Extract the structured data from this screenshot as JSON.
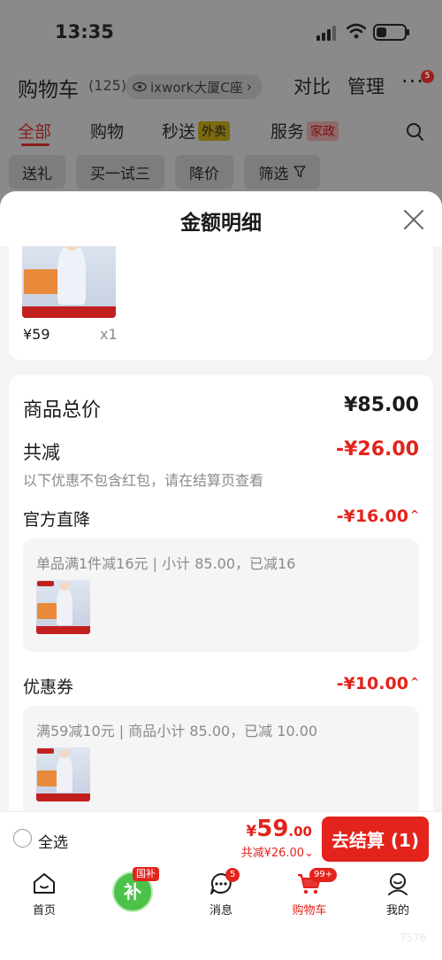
{
  "status_bar": {
    "time": "13:35"
  },
  "cart_header": {
    "title": "购物车",
    "count": "(125)",
    "location": "ixwork大厦C座",
    "compare": "对比",
    "manage": "管理",
    "more_badge": "5"
  },
  "tabs": [
    {
      "label": "全部",
      "active": true
    },
    {
      "label": "购物"
    },
    {
      "label": "秒送",
      "tag": "外卖"
    },
    {
      "label": "服务",
      "tag": "家政"
    }
  ],
  "filters": [
    "送礼",
    "买一试三",
    "降价",
    "筛选"
  ],
  "sheet": {
    "title": "金额明细",
    "item": {
      "price": "¥59",
      "qty": "x1"
    },
    "total_label": "商品总价",
    "total_value": "¥85.00",
    "reduce_label": "共减",
    "reduce_value": "-¥26.00",
    "reduce_note": "以下优惠不包含红包，请在结算页查看",
    "official": {
      "label": "官方直降",
      "value": "-¥16.00",
      "desc": "单品满1件减16元 | 小计 85.00，已减16"
    },
    "coupon": {
      "label": "优惠券",
      "value": "-¥10.00",
      "desc": "满59减10元 | 商品小计 85.00，已减 10.00"
    }
  },
  "checkout": {
    "select_all": "全选",
    "currency": "¥",
    "price_int": "59",
    "price_dec": ".00",
    "discount": "共减¥26.00",
    "button": "去结算 (1)"
  },
  "tabbar": [
    {
      "label": "首页",
      "icon": "home-icon"
    },
    {
      "label": "",
      "icon": "national-subsidy-icon",
      "tag": "国补",
      "glyph": "补"
    },
    {
      "label": "消息",
      "icon": "message-icon",
      "badge": "5"
    },
    {
      "label": "购物车",
      "icon": "cart-icon",
      "badge": "99+",
      "active": true
    },
    {
      "label": "我的",
      "icon": "profile-icon"
    }
  ],
  "colors": {
    "accent": "#e3231c",
    "sheet_bg": "#f4f4f4",
    "overlay": "#8a8a8a"
  },
  "watermark": "7576"
}
